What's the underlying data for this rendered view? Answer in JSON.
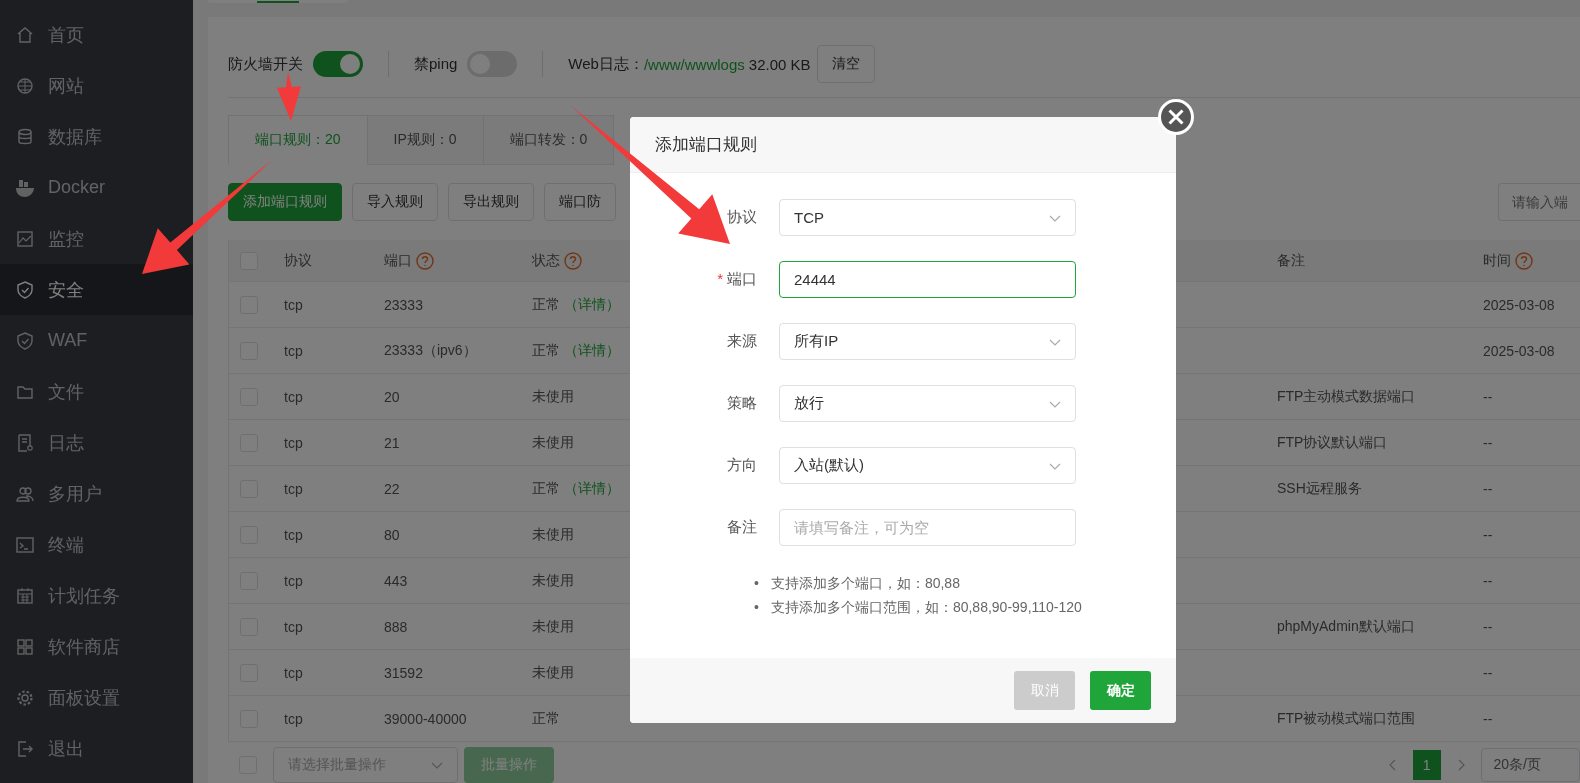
{
  "sidebar": {
    "items": [
      {
        "label": "首页",
        "selected": false
      },
      {
        "label": "网站",
        "selected": false
      },
      {
        "label": "数据库",
        "selected": false
      },
      {
        "label": "Docker",
        "selected": false
      },
      {
        "label": "监控",
        "selected": false
      },
      {
        "label": "安全",
        "selected": true
      },
      {
        "label": "WAF",
        "selected": false
      },
      {
        "label": "文件",
        "selected": false
      },
      {
        "label": "日志",
        "selected": false
      },
      {
        "label": "多用户",
        "selected": false
      },
      {
        "label": "终端",
        "selected": false
      },
      {
        "label": "计划任务",
        "selected": false
      },
      {
        "label": "软件商店",
        "selected": false
      },
      {
        "label": "面板设置",
        "selected": false
      },
      {
        "label": "退出",
        "selected": false
      }
    ]
  },
  "toolbar": {
    "toggles": [
      {
        "label": "防火墙开关",
        "on": true
      },
      {
        "label": "禁ping",
        "on": false
      }
    ],
    "web_log": {
      "label": "Web日志：",
      "path": "/www/wwwlogs",
      "size": "32.00 KB",
      "button": "清空"
    }
  },
  "tabs": [
    {
      "label": "端口规则：20",
      "selected": true
    },
    {
      "label": "IP规则：0",
      "selected": false
    },
    {
      "label": "端口转发：0",
      "selected": false
    }
  ],
  "actions": [
    {
      "label": "添加端口规则",
      "primary": true
    },
    {
      "label": "导入规则",
      "primary": false
    },
    {
      "label": "导出规则",
      "primary": false
    },
    {
      "label": "端口防",
      "primary": false
    }
  ],
  "search": {
    "placeholder": "请输入端"
  },
  "table": {
    "all_checked": false,
    "columns": [
      {
        "label": "协议",
        "help": false
      },
      {
        "label": "端口",
        "help": true
      },
      {
        "label": "状态",
        "help": true
      },
      {
        "label": "备注",
        "help": false
      },
      {
        "label": "时间",
        "help": true
      }
    ],
    "rows": [
      {
        "checked": false,
        "protocol": "tcp",
        "port": "23333",
        "status": "正常",
        "detail": "（详情）",
        "time": "2025-03-08"
      },
      {
        "checked": false,
        "protocol": "tcp",
        "port": "23333（ipv6）",
        "status": "正常",
        "detail": "（详情）",
        "time": "2025-03-08"
      },
      {
        "checked": false,
        "protocol": "tcp",
        "port": "20",
        "status": "未使用",
        "remark": "FTP主动模式数据端口",
        "time": "--"
      },
      {
        "checked": false,
        "protocol": "tcp",
        "port": "21",
        "status": "未使用",
        "remark": "FTP协议默认端口",
        "time": "--"
      },
      {
        "checked": false,
        "protocol": "tcp",
        "port": "22",
        "status": "正常",
        "detail": "（详情）",
        "remark": "SSH远程服务",
        "time": "--"
      },
      {
        "checked": false,
        "protocol": "tcp",
        "port": "80",
        "status": "未使用",
        "time": "--"
      },
      {
        "checked": false,
        "protocol": "tcp",
        "port": "443",
        "status": "未使用",
        "time": "--"
      },
      {
        "checked": false,
        "protocol": "tcp",
        "port": "888",
        "status": "未使用",
        "remark": "phpMyAdmin默认端口",
        "time": "--"
      },
      {
        "checked": false,
        "protocol": "tcp",
        "port": "31592",
        "status": "未使用",
        "time": "--"
      },
      {
        "checked": false,
        "protocol": "tcp",
        "port": "39000-40000",
        "status": "正常",
        "remark": "FTP被动模式端口范围",
        "time": "--"
      }
    ]
  },
  "footer": {
    "checked": false,
    "batch_select": {
      "placeholder": "请选择批量操作"
    },
    "batch_button": "批量操作",
    "pagination": {
      "pages": [
        {
          "label": "1",
          "selected": true
        }
      ],
      "page_size": "20条/页"
    }
  },
  "dialog": {
    "title": "添加端口规则",
    "fields": [
      {
        "label": "协议",
        "kind": "select",
        "value": "TCP",
        "required": false,
        "focused": false
      },
      {
        "label": "端口",
        "kind": "input",
        "value": "24444",
        "required": true,
        "required_mark": "*",
        "focused": true
      },
      {
        "label": "来源",
        "kind": "select",
        "value": "所有IP",
        "required": false,
        "focused": false
      },
      {
        "label": "策略",
        "kind": "select",
        "value": "放行",
        "required": false,
        "focused": false
      },
      {
        "label": "方向",
        "kind": "select",
        "value": "入站(默认)",
        "required": false,
        "focused": false
      },
      {
        "label": "备注",
        "kind": "input",
        "placeholder": "请填写备注，可为空",
        "required": false,
        "focused": false
      }
    ],
    "tips": [
      {
        "bullet": "•",
        "text": "支持添加多个端口，如：80,88"
      },
      {
        "bullet": "•",
        "text": "支持添加多个端口范围，如：80,88,90-99,110-120"
      }
    ],
    "buttons": [
      {
        "label": "取消",
        "primary": false
      },
      {
        "label": "确定",
        "primary": true
      }
    ]
  }
}
